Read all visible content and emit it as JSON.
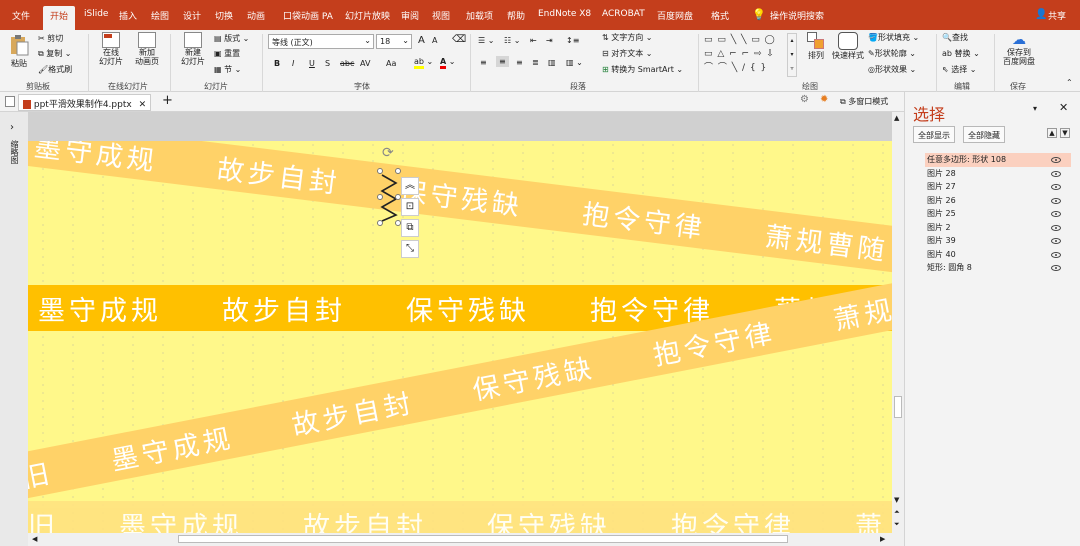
{
  "menu_tabs": [
    "文件",
    "开始",
    "iSlide",
    "插入",
    "绘图",
    "设计",
    "切换",
    "动画",
    "口袋动画 PA",
    "幻灯片放映",
    "审阅",
    "视图",
    "加载项",
    "帮助",
    "EndNote X8",
    "ACROBAT",
    "百度网盘",
    "格式"
  ],
  "active_tab": "开始",
  "search_label": "操作说明搜索",
  "share_label": "共享",
  "ribbon": {
    "clipboard": {
      "paste": "粘贴",
      "cut": "剪切",
      "copy": "复制",
      "format_painter": "格式刷",
      "label": "剪贴板"
    },
    "online": {
      "online_slide": "在线\n幻灯片",
      "new_anim": "新加\n动画页",
      "label": "在线幻灯片"
    },
    "slides": {
      "new_slide": "新建\n幻灯片",
      "layout": "版式",
      "reset": "重置",
      "section": "节",
      "label": "幻灯片"
    },
    "font": {
      "font_name": "等线 (正文)",
      "font_size": "18",
      "label": "字体",
      "bold": "B",
      "italic": "I",
      "underline": "U",
      "strike": "S",
      "abc": "abc",
      "spacing": "AV",
      "case": "Aa",
      "grow": "A",
      "shrink": "A"
    },
    "paragraph": {
      "text_direction": "文字方向",
      "align_text": "对齐文本",
      "smartart": "转换为 SmartArt",
      "label": "段落"
    },
    "drawing": {
      "arrange": "排列",
      "quick_styles": "快速样式",
      "shape_fill": "形状填充",
      "shape_outline": "形状轮廓",
      "shape_effects": "形状效果",
      "label": "绘图"
    },
    "editing": {
      "find": "查找",
      "replace": "替换",
      "select": "选择",
      "label": "编辑"
    },
    "save": {
      "save_to_baidu": "保存到\n百度网盘",
      "label": "保存"
    }
  },
  "document_tab": "ppt平滑效果制作4.pptx",
  "multi_window": "多窗口模式",
  "left_strip_label": "缩略图",
  "slide_bands": {
    "phrases": [
      "墨守成规",
      "故步自封",
      "保守残缺",
      "抱令守律",
      "萧规曹随"
    ],
    "bottom_phrases": [
      "旧",
      "墨守成规",
      "故步自封",
      "保守残缺",
      "抱令守律",
      "萧"
    ]
  },
  "colors": {
    "accent": "#c43e1c",
    "slide_bg": "#fff88a",
    "band_dark": "#ffc000",
    "band_light": "#ffd268",
    "band_pale": "#ffe27f"
  },
  "selection_pane": {
    "title": "选择",
    "show_all": "全部显示",
    "hide_all": "全部隐藏",
    "items": [
      {
        "label": "任意多边形: 形状 108",
        "selected": true
      },
      {
        "label": "图片 28",
        "selected": false
      },
      {
        "label": "图片 27",
        "selected": false
      },
      {
        "label": "图片 26",
        "selected": false
      },
      {
        "label": "图片 25",
        "selected": false
      },
      {
        "label": "图片 2",
        "selected": false
      },
      {
        "label": "图片 39",
        "selected": false
      },
      {
        "label": "图片 40",
        "selected": false
      },
      {
        "label": "矩形: 圆角 8",
        "selected": false
      }
    ]
  }
}
